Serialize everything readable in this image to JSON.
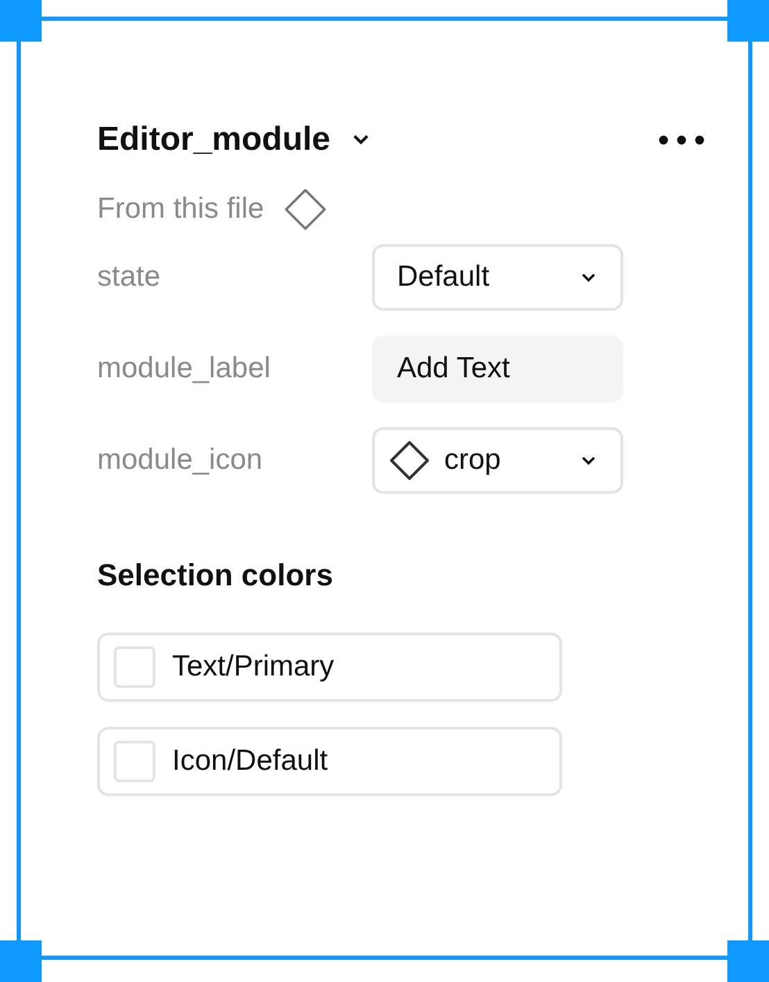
{
  "component": {
    "title": "Editor_module",
    "source": "From this file"
  },
  "properties": [
    {
      "kind": "dropdown",
      "label": "state",
      "value": "Default"
    },
    {
      "kind": "text",
      "label": "module_label",
      "value": "Add Text"
    },
    {
      "kind": "icon-dropdown",
      "label": "module_icon",
      "value": "crop"
    }
  ],
  "selection_colors": {
    "title": "Selection colors",
    "items": [
      {
        "name": "Text/Primary",
        "color": "#ffffff"
      },
      {
        "name": "Icon/Default",
        "color": "#ffffff"
      }
    ]
  }
}
